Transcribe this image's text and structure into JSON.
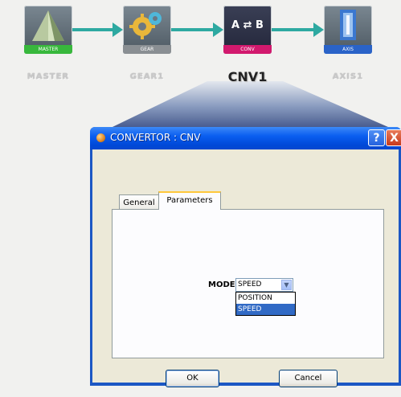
{
  "workflow": {
    "nodes": [
      {
        "band": "MASTER",
        "label": "MASTER",
        "band_color": "#38b83c"
      },
      {
        "band": "GEAR",
        "label": "GEAR1",
        "band_color": "#8a8f93"
      },
      {
        "icon_text": "A ⇄ B",
        "band": "CONV",
        "label": "CNV1",
        "band_color": "#d2196e"
      },
      {
        "band": "AXIS",
        "label": "AXIS1",
        "band_color": "#2a63c8"
      }
    ],
    "arrow_color": "#2ea9a1"
  },
  "dialog": {
    "title": "CONVERTOR : CNV",
    "help": "?",
    "close": "X",
    "tabs": [
      "General",
      "Parameters"
    ],
    "active_tab": "Parameters",
    "mode": {
      "label": "MODE",
      "value": "SPEED",
      "options": [
        "POSITION",
        "SPEED"
      ],
      "highlighted": "SPEED"
    },
    "ok": "OK",
    "cancel": "Cancel"
  }
}
